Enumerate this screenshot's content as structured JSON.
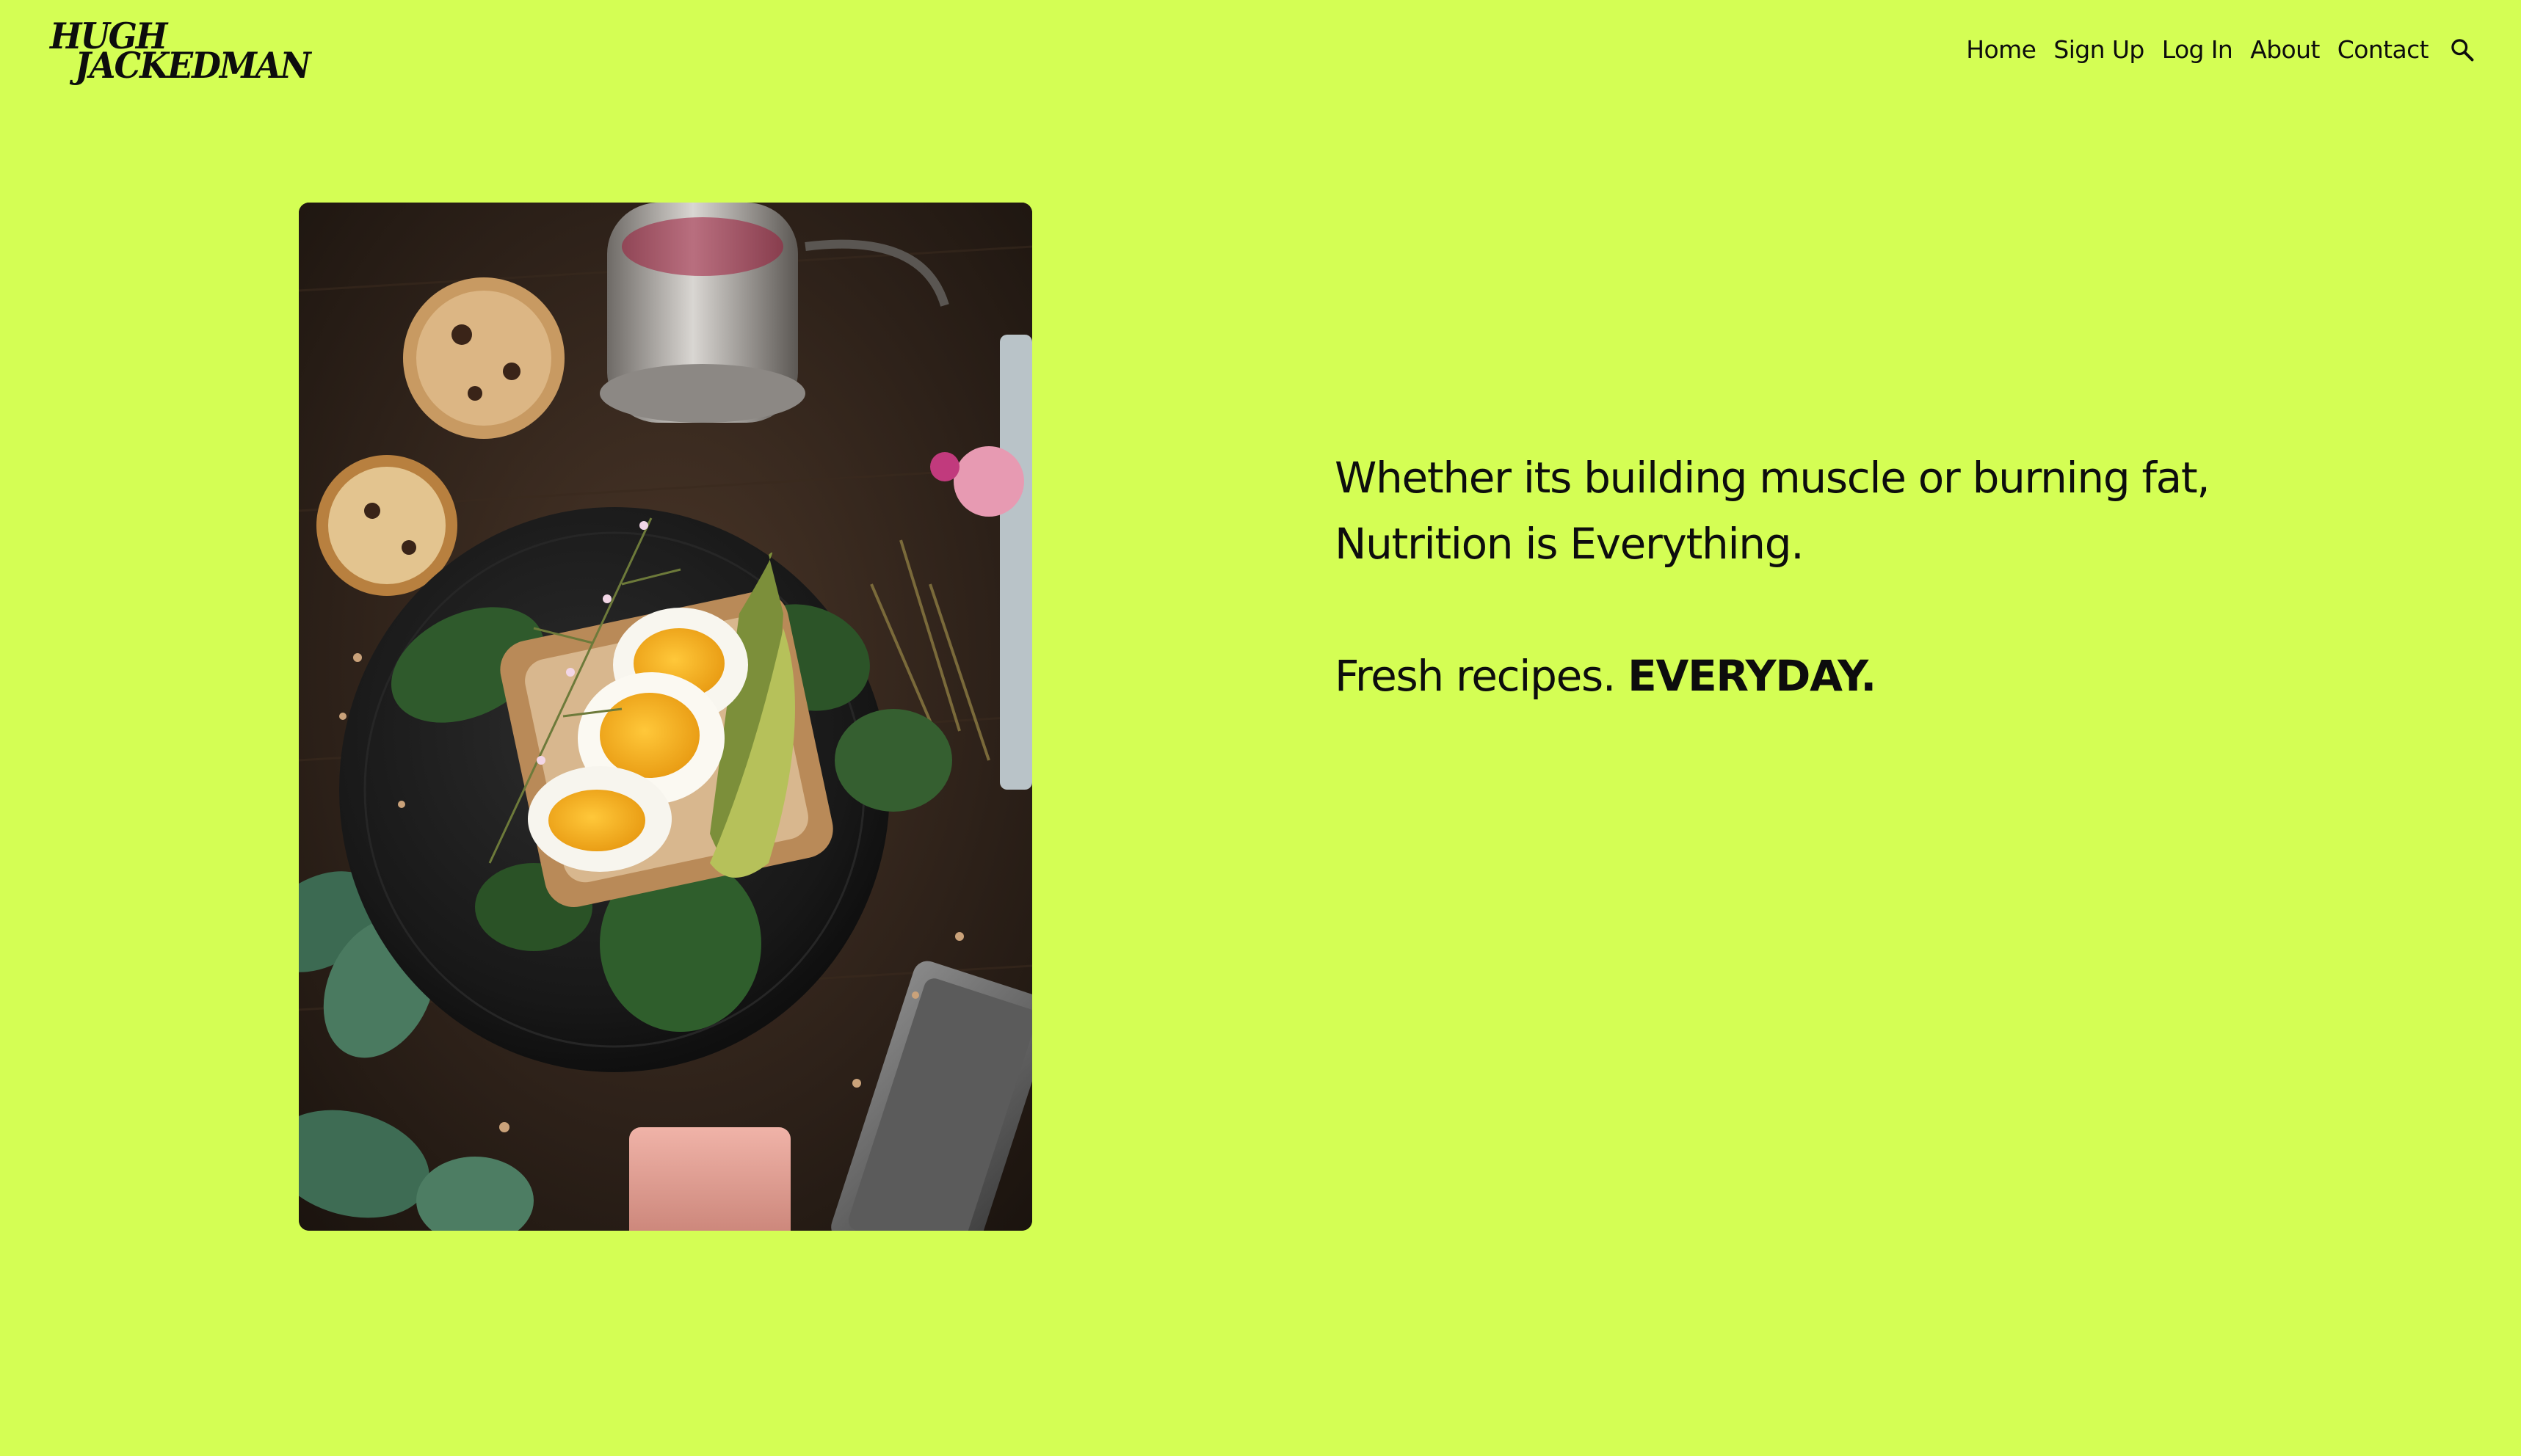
{
  "brand": {
    "logo_line1": "HUGH",
    "logo_line2": "JACKEDMAN"
  },
  "nav": {
    "items": [
      {
        "label": "Home"
      },
      {
        "label": "Sign Up"
      },
      {
        "label": "Log In"
      },
      {
        "label": "About"
      },
      {
        "label": "Contact"
      }
    ],
    "search_icon": "search-icon"
  },
  "hero": {
    "image_icon": "food-photo-eggs-avocado-toast",
    "headline_line1": "Whether its building muscle or burning fat,",
    "headline_line2": "Nutrition is Everything.",
    "tagline_regular": "Fresh recipes.",
    "tagline_bold": "EVERYDAY."
  },
  "colors": {
    "background": "#d4fe54",
    "text": "#0d0d0d"
  }
}
